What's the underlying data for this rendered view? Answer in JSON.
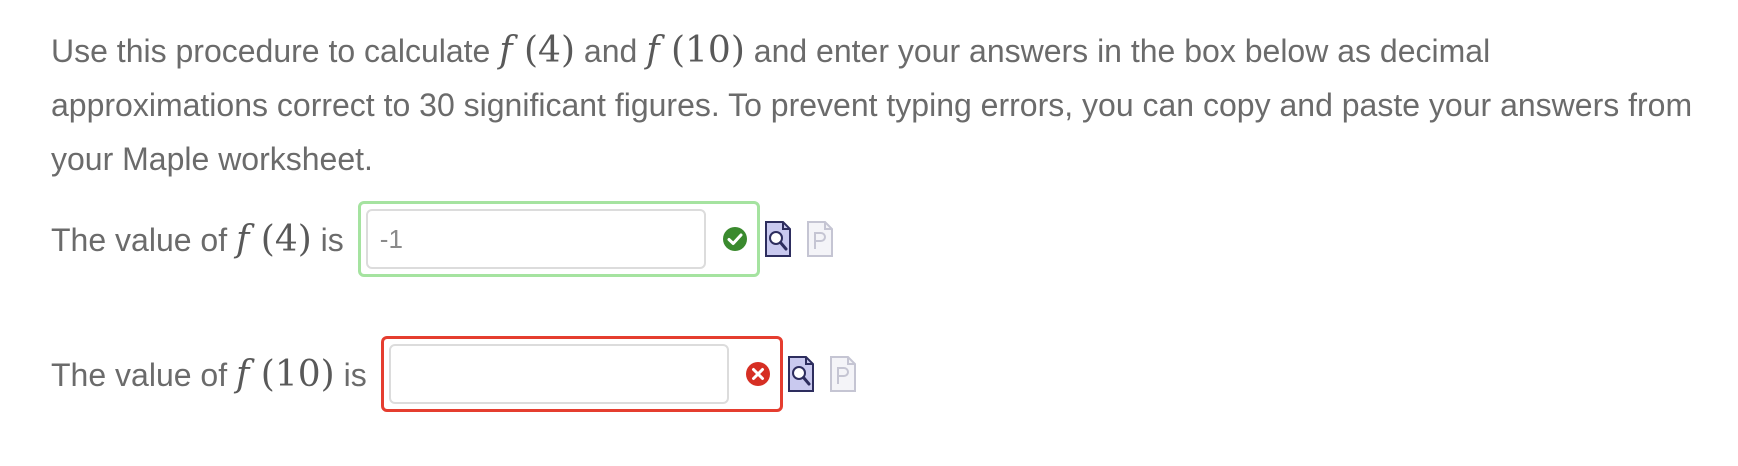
{
  "instructions": {
    "part1": "Use this procedure to calculate ",
    "math_a": "(4)",
    "part2": " and ",
    "math_b": "(10)",
    "part3": " and enter your answers in the box below as decimal approximations correct to 30 significant figures. To prevent typing errors, you can copy and paste your answers from your Maple worksheet."
  },
  "function_symbol": "f",
  "answers": [
    {
      "prompt_before": "The value of ",
      "math_arg": "(4)",
      "prompt_after": " is",
      "value": "-1",
      "status": "correct"
    },
    {
      "prompt_before": "The value of ",
      "math_arg": "(10)",
      "prompt_after": " is",
      "value": "",
      "status": "incorrect"
    }
  ],
  "colors": {
    "correct_border": "#a5e3a0",
    "incorrect_border": "#e53d2f",
    "correct_icon": "#3a8a2e",
    "incorrect_icon": "#d62f24"
  },
  "icons": {
    "preview": "preview-magnifier-icon",
    "plot": "plot-page-icon",
    "correct": "check-circle-icon",
    "incorrect": "x-circle-icon"
  }
}
